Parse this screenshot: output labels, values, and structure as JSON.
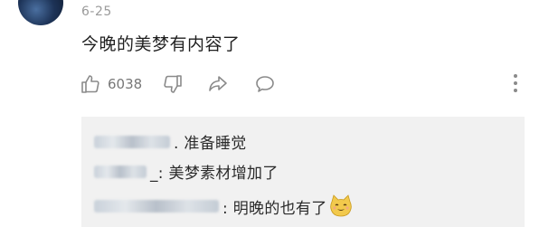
{
  "comment": {
    "date": "6-25",
    "text": "今晚的美梦有内容了",
    "like_count": "6038"
  },
  "icons": {
    "like": "thumbs-up-icon",
    "dislike": "thumbs-down-icon",
    "share": "share-arrow-icon",
    "reply": "speech-bubble-icon",
    "more": "more-vertical-icon",
    "emoji": "cat-face-emoji-icon"
  },
  "replies": [
    {
      "text": ". 准备睡觉"
    },
    {
      "text": "_: 美梦素材增加了"
    },
    {
      "text": ": 明晚的也有了"
    }
  ],
  "colors": {
    "reply_bg": "#f1f1f1",
    "meta_text": "#9a9a9a"
  }
}
